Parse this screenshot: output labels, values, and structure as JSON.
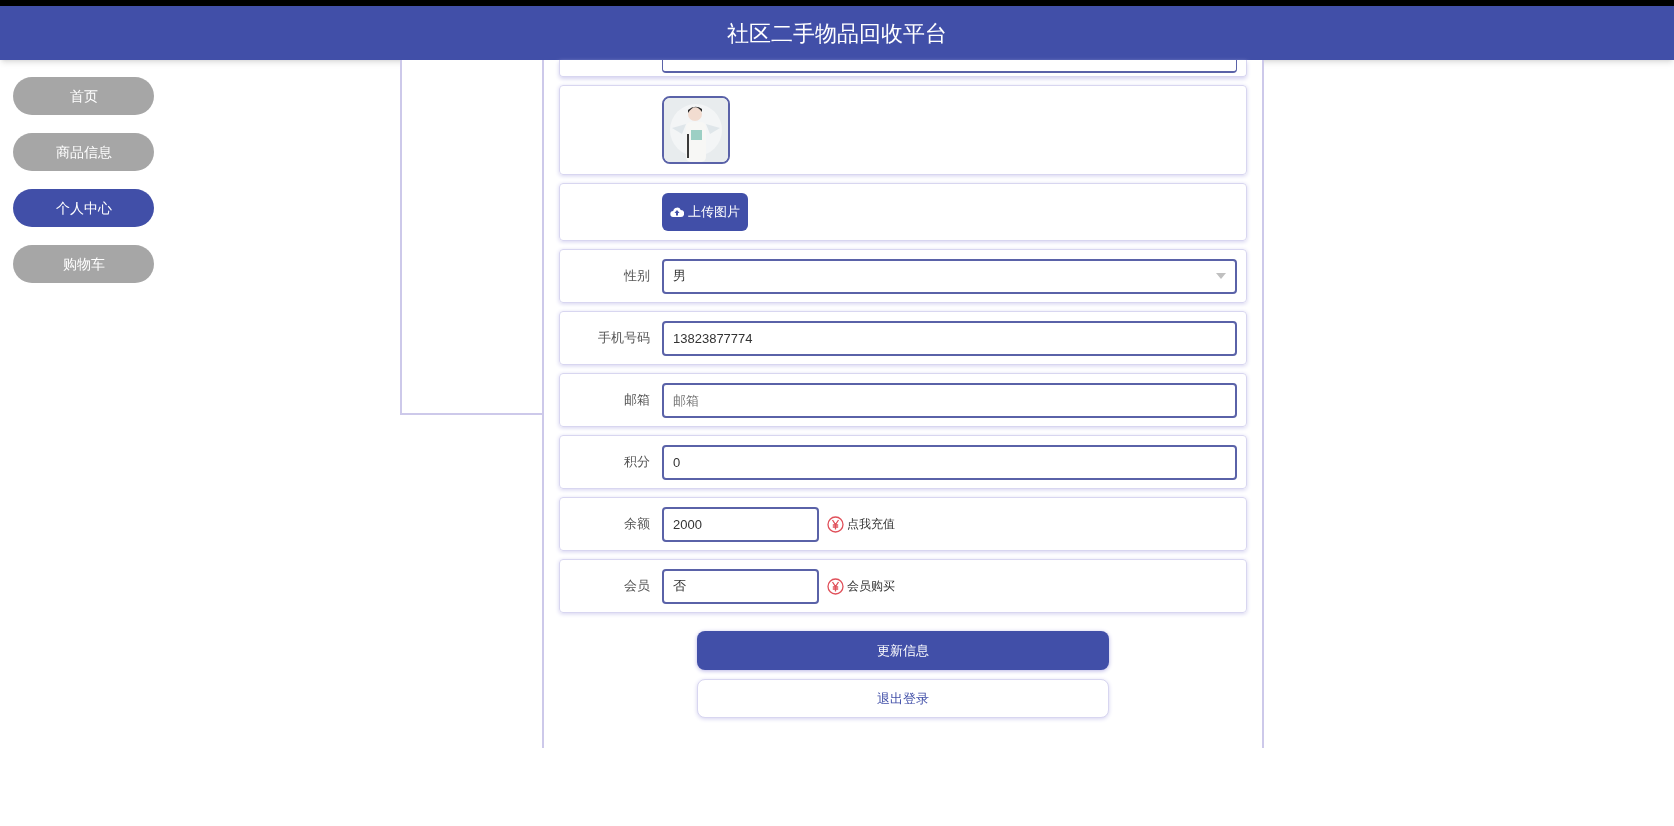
{
  "header": {
    "title": "社区二手物品回收平台"
  },
  "sidebar": {
    "items": [
      {
        "label": "首页",
        "selected": false
      },
      {
        "label": "商品信息",
        "selected": false
      },
      {
        "label": "个人中心",
        "selected": true
      },
      {
        "label": "购物车",
        "selected": false
      }
    ]
  },
  "form": {
    "upload_button": "上传图片",
    "fields": [
      {
        "label": "性别",
        "kind": "select",
        "value": "男"
      },
      {
        "label": "手机号码",
        "kind": "text",
        "value": "13823877774"
      },
      {
        "label": "邮箱",
        "kind": "text",
        "placeholder": "邮箱"
      },
      {
        "label": "积分",
        "kind": "text",
        "value": "0"
      },
      {
        "label": "余额",
        "kind": "short",
        "value": "2000",
        "action": "点我充值"
      },
      {
        "label": "会员",
        "kind": "short",
        "value": "否",
        "action": "会员购买"
      }
    ]
  },
  "buttons": [
    {
      "label": "更新信息",
      "kind": "primary"
    },
    {
      "label": "退出登录",
      "kind": "secondary"
    }
  ]
}
